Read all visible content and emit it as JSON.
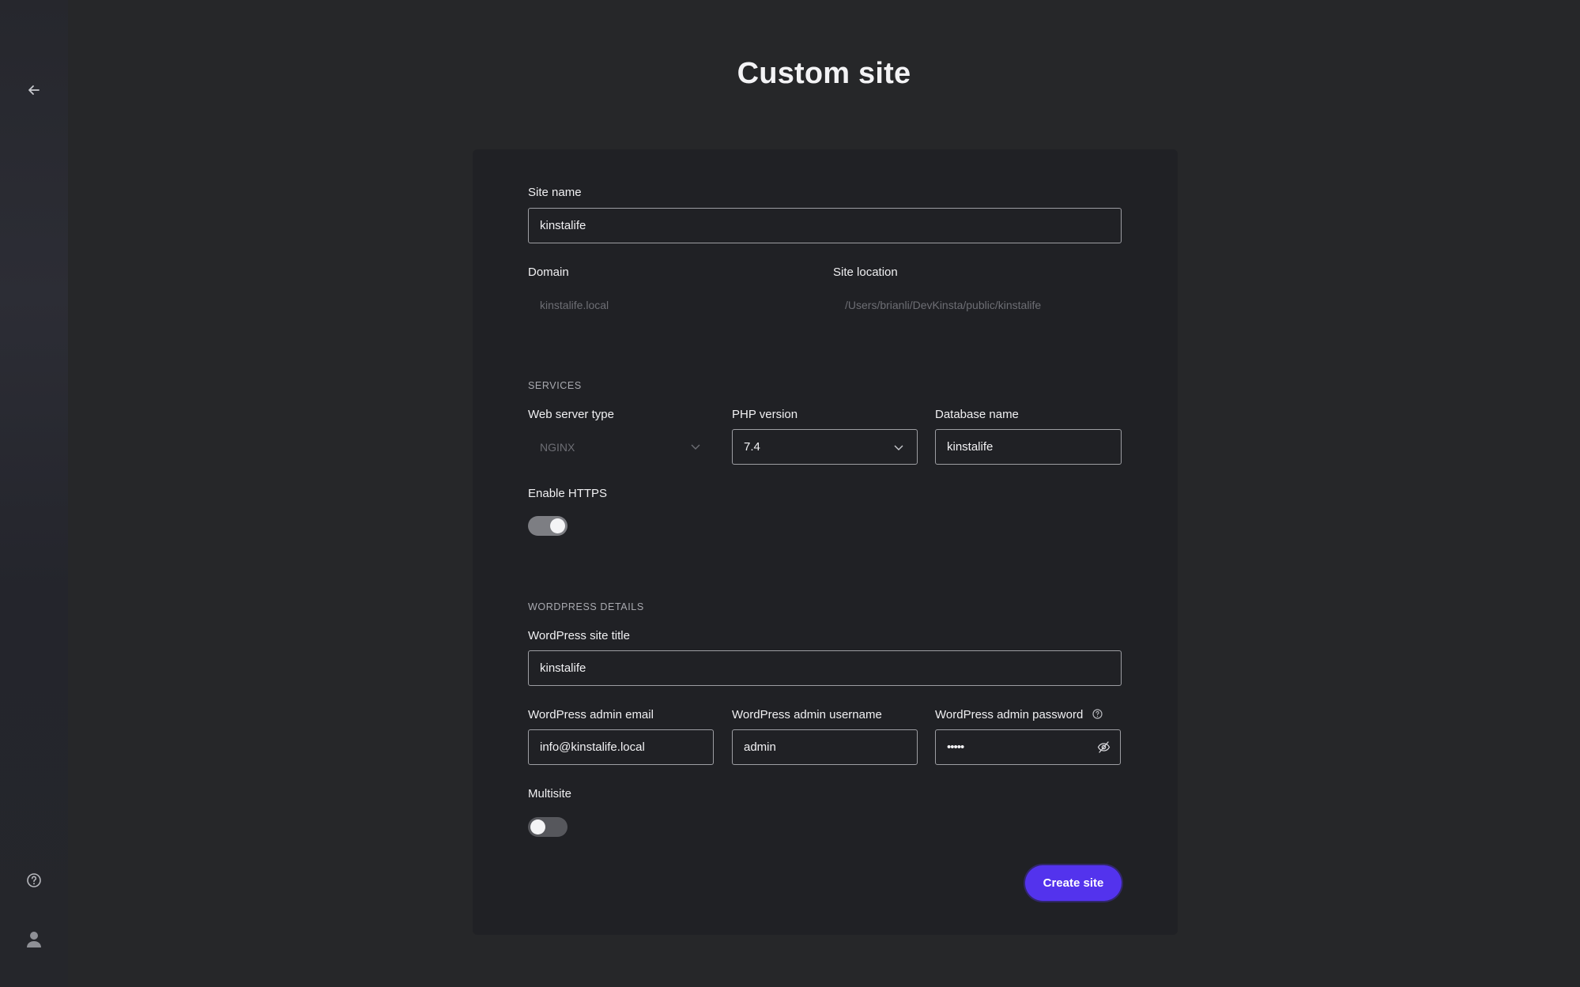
{
  "page": {
    "title": "Custom site"
  },
  "sidebar": {
    "back_icon": "arrow-left-icon",
    "help_icon": "help-circle-icon",
    "user_icon": "user-avatar-icon"
  },
  "form": {
    "site_name": {
      "label": "Site name",
      "value": "kinstalife"
    },
    "domain": {
      "label": "Domain",
      "value": "kinstalife.local"
    },
    "site_location": {
      "label": "Site location",
      "value": "/Users/brianli/DevKinsta/public/kinstalife"
    },
    "services": {
      "heading": "SERVICES",
      "web_server": {
        "label": "Web server type",
        "value": "NGINX"
      },
      "php_version": {
        "label": "PHP version",
        "value": "7.4"
      },
      "database_name": {
        "label": "Database name",
        "value": "kinstalife"
      },
      "https": {
        "label": "Enable HTTPS",
        "enabled": true
      }
    },
    "wordpress": {
      "heading": "WORDPRESS DETAILS",
      "site_title": {
        "label": "WordPress site title",
        "value": "kinstalife"
      },
      "admin_email": {
        "label": "WordPress admin email",
        "value": "info@kinstalife.local"
      },
      "admin_username": {
        "label": "WordPress admin username",
        "value": "admin"
      },
      "admin_password": {
        "label": "WordPress admin password",
        "value": "•••••",
        "help_icon": "info-circle-icon",
        "toggle_icon": "eye-off-icon"
      },
      "multisite": {
        "label": "Multisite",
        "enabled": false
      }
    },
    "submit_label": "Create site"
  },
  "colors": {
    "background": "#262729",
    "card": "#202125",
    "accent": "#5333ed",
    "toggle_on": "#7d7e83",
    "toggle_off": "#56575c"
  }
}
